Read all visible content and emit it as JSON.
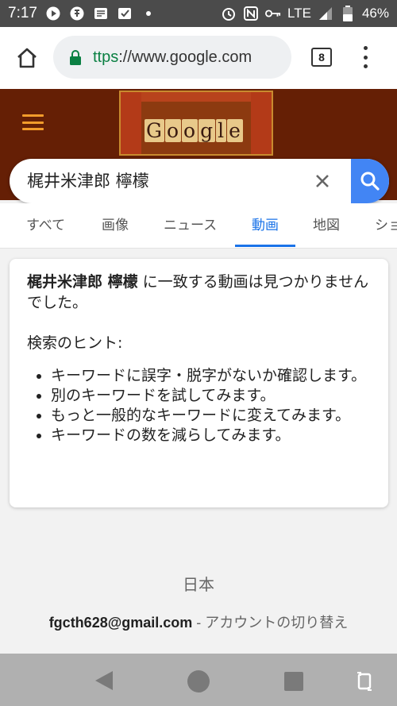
{
  "status_bar": {
    "time": "7:17",
    "network": "LTE",
    "battery": "46%"
  },
  "browser": {
    "url_scheme": "ttps",
    "url_rest": "://www.google.com",
    "tab_count": "8"
  },
  "header": {
    "doodle_letters": [
      "G",
      "o",
      "o",
      "g",
      "l",
      "e"
    ]
  },
  "search": {
    "query": "梶井米津郎 檸檬"
  },
  "tabs": [
    {
      "label": "すべて"
    },
    {
      "label": "画像"
    },
    {
      "label": "ニュース"
    },
    {
      "label": "動画"
    },
    {
      "label": "地図"
    },
    {
      "label": "ショ"
    }
  ],
  "result": {
    "query_bold": "梶井米津郎 檸檬",
    "message_rest": " に一致する動画は見つかりませんでした。",
    "hints_title": "検索のヒント:",
    "hints": [
      "キーワードに誤字・脱字がないか確認します。",
      "別のキーワードを試してみます。",
      "もっと一般的なキーワードに変えてみます。",
      "キーワードの数を減らしてみます。"
    ]
  },
  "footer": {
    "country": "日本",
    "email": "fgcth628@gmail.com",
    "switch_account": " - アカウントの切り替え"
  },
  "colors": {
    "header_bg": "#651f05",
    "accent": "#1a73e8",
    "search_button": "#4285f4",
    "menu_icon": "#f29c2b",
    "secure_green": "#0b8043"
  }
}
